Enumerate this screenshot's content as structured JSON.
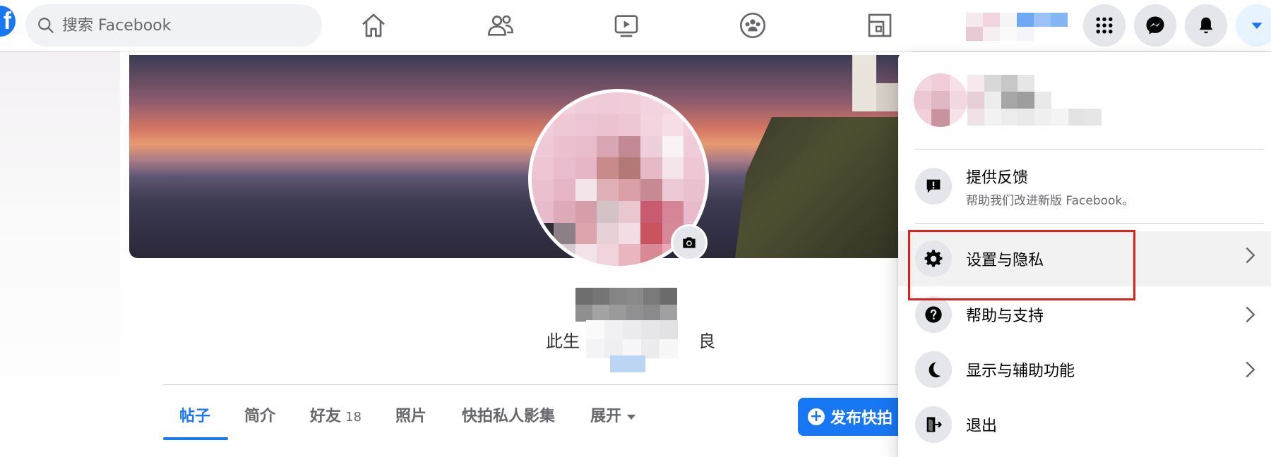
{
  "topbar": {
    "logo": "f",
    "search_placeholder": "搜索 Facebook",
    "nav": [
      {
        "name": "home-icon"
      },
      {
        "name": "friends-icon"
      },
      {
        "name": "watch-icon"
      },
      {
        "name": "groups-icon"
      },
      {
        "name": "gaming-icon"
      }
    ],
    "actions": [
      {
        "name": "menu-grid-icon"
      },
      {
        "name": "messenger-icon"
      },
      {
        "name": "notifications-bell-icon"
      },
      {
        "name": "account-caret-icon"
      }
    ]
  },
  "profile": {
    "bio_visible": "此生",
    "bio_tail": "良",
    "tabs": [
      {
        "label": "帖子",
        "active": true
      },
      {
        "label": "简介"
      },
      {
        "label": "好友",
        "count": "18"
      },
      {
        "label": "照片"
      },
      {
        "label": "快拍私人影集"
      },
      {
        "label": "展开"
      }
    ],
    "post_button": "发布快拍",
    "post_button_icon": "+"
  },
  "menu": {
    "items": [
      {
        "label": "提供反馈",
        "sub": "帮助我们改进新版 Facebook。",
        "icon": "feedback-icon"
      },
      {
        "label": "设置与隐私",
        "icon": "gear-icon",
        "chevron": true
      },
      {
        "label": "帮助与支持",
        "icon": "help-icon",
        "chevron": true
      },
      {
        "label": "显示与辅助功能",
        "icon": "moon-icon",
        "chevron": true
      },
      {
        "label": "退出",
        "icon": "logout-icon"
      }
    ]
  },
  "colors": {
    "accent": "#1877f2",
    "highlight": "#e0201a",
    "icon_bg": "#e4e6eb"
  }
}
